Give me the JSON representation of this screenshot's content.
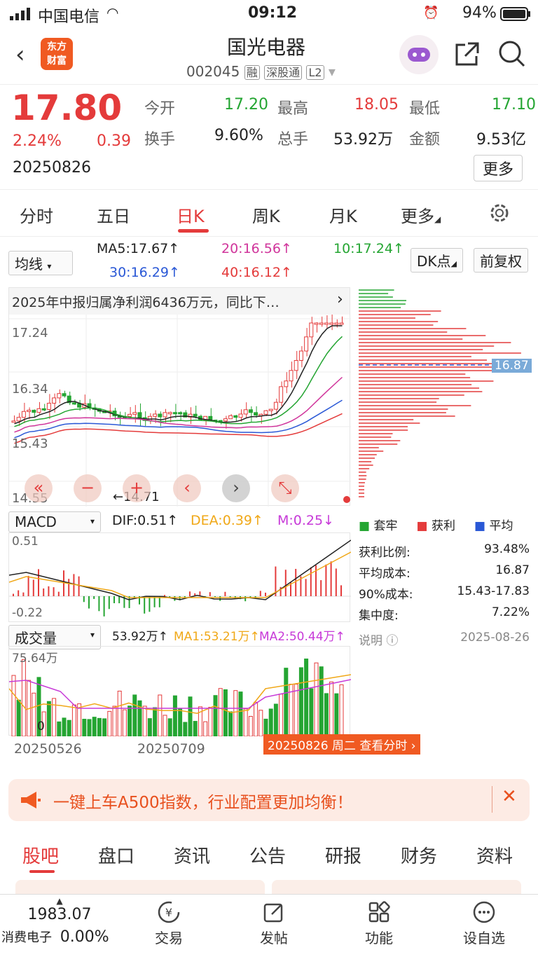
{
  "statusbar": {
    "carrier": "中国电信",
    "time": "09:12",
    "battery": "94%"
  },
  "header": {
    "logo_line1": "东方",
    "logo_line2": "财富",
    "stock_name": "国光电器",
    "stock_code": "002045",
    "tag1": "融",
    "tag2": "深股通",
    "tag3": "L2"
  },
  "quote": {
    "price": "17.80",
    "change_pct": "2.24%",
    "change_amt": "0.39",
    "date": "20250826",
    "open_label": "今开",
    "open": "17.20",
    "high_label": "最高",
    "high": "18.05",
    "low_label": "最低",
    "low": "17.10",
    "turnover_label": "换手",
    "turnover": "9.60%",
    "volume_label": "总手",
    "volume": "53.92万",
    "amount_label": "金额",
    "amount": "9.53亿",
    "more": "更多"
  },
  "period_tabs": [
    "分时",
    "五日",
    "日K",
    "周K",
    "月K",
    "更多"
  ],
  "ma": {
    "selector": "均线",
    "ma5": "MA5:17.67↑",
    "ma20": "20:16.56↑",
    "ma10": "10:17.24↑",
    "ma30": "30:16.29↑",
    "ma40": "40:16.12↑",
    "dk": "DK点",
    "fq": "前复权"
  },
  "news": "2025年中报归属净利润6436万元，同比下…",
  "kchart": {
    "y_high": "17.24",
    "y_mid": "16.34",
    "y_low_label": "15.43",
    "y_bottom": "14.55",
    "low_mark": "←14.71",
    "price_tag": "16.87"
  },
  "macd": {
    "selector": "MACD",
    "dif": "DIF:0.51↑",
    "dea": "DEA:0.39↑",
    "m": "M:0.25↓",
    "top": "0.51",
    "bottom": "-0.22"
  },
  "volume": {
    "selector": "成交量",
    "v": "53.92万↑",
    "ma1": "MA1:53.21万↑",
    "ma2": "MA2:50.44万↑",
    "top": "75.64万",
    "zero": "0",
    "date1": "20250526",
    "date2": "20250709",
    "cursor": "20250826 周二 查看分时"
  },
  "chips": {
    "legend_trapped": "套牢",
    "legend_profit": "获利",
    "legend_avg": "平均",
    "rows": [
      {
        "label": "获利比例:",
        "value": "93.48%"
      },
      {
        "label": "平均成本:",
        "value": "16.87"
      },
      {
        "label": "90%成本:",
        "value": "15.43-17.83"
      },
      {
        "label": "集中度:",
        "value": "7.22%"
      }
    ],
    "note": "说明",
    "date": "2025-08-26"
  },
  "banner": {
    "text": "一键上车A500指数，行业配置更加均衡！"
  },
  "bottom_tabs": [
    "股吧",
    "盘口",
    "资讯",
    "公告",
    "研报",
    "财务",
    "资料"
  ],
  "bottombar": {
    "index_value": "1983.07",
    "index_name": "消费电子",
    "index_change": "0.00%",
    "trade": "交易",
    "post": "发帖",
    "func": "功能",
    "watch": "设自选"
  }
}
